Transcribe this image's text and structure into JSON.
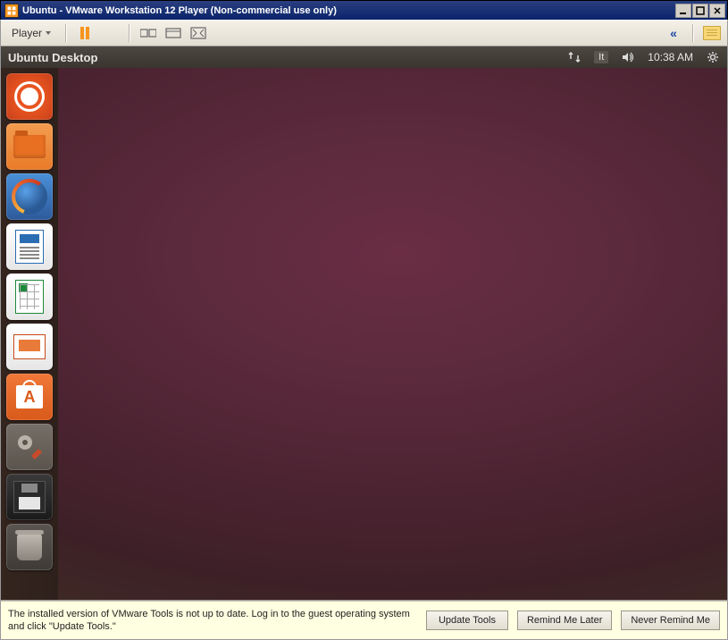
{
  "window": {
    "title": "Ubuntu - VMware Workstation 12 Player (Non-commercial use only)"
  },
  "player_toolbar": {
    "menu_label": "Player"
  },
  "ubuntu_panel": {
    "title": "Ubuntu Desktop",
    "lang": "It",
    "clock": "10:38 AM"
  },
  "launcher": {
    "items": [
      {
        "name": "dash"
      },
      {
        "name": "files"
      },
      {
        "name": "firefox"
      },
      {
        "name": "writer"
      },
      {
        "name": "calc"
      },
      {
        "name": "impress"
      },
      {
        "name": "software-center"
      },
      {
        "name": "system-settings"
      },
      {
        "name": "floppy"
      },
      {
        "name": "trash"
      }
    ]
  },
  "notification": {
    "message": "The installed version of VMware Tools is not up to date. Log in to the guest operating system and click \"Update Tools.\"",
    "buttons": {
      "update": "Update Tools",
      "remind": "Remind Me Later",
      "never": "Never Remind Me"
    }
  }
}
